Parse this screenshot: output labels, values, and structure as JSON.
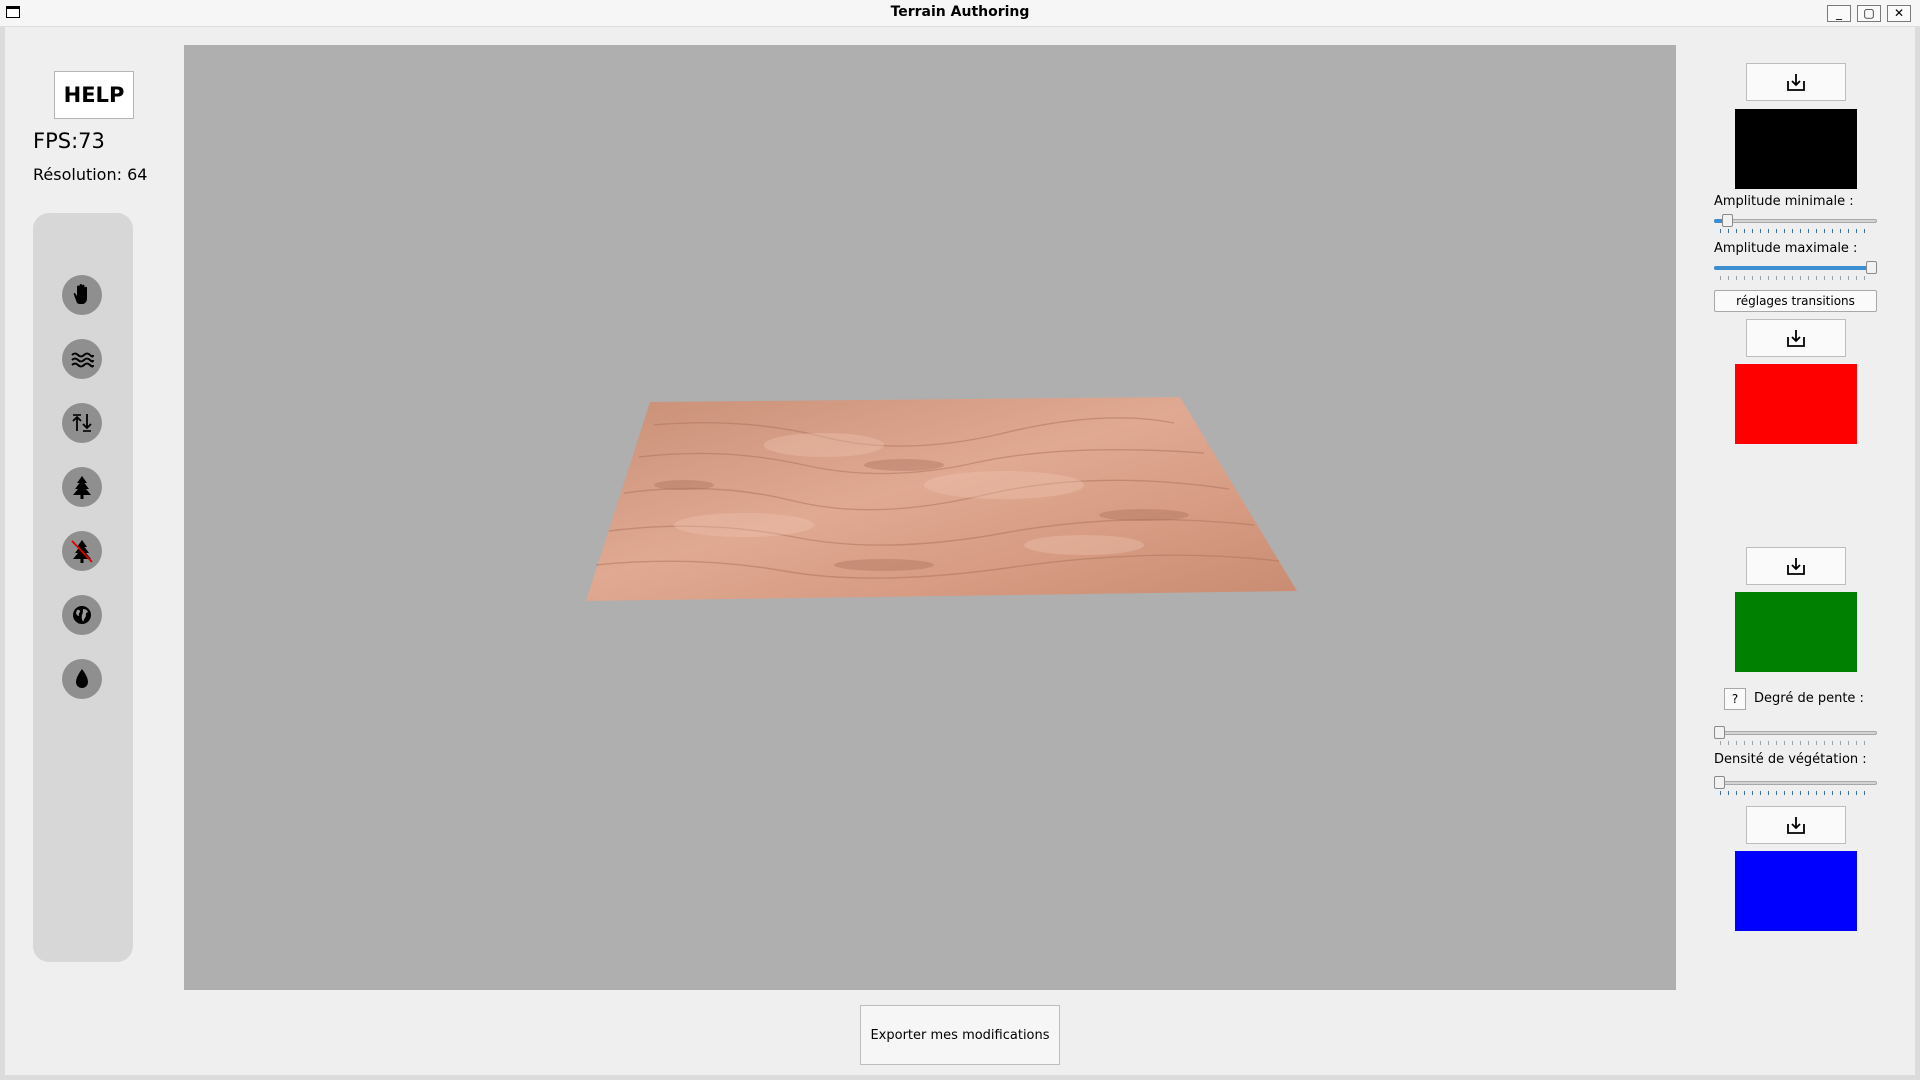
{
  "window": {
    "title": "Terrain Authoring"
  },
  "left": {
    "help_label": "HELP",
    "fps": "FPS:73",
    "resolution": "Résolution: 64"
  },
  "tools": [
    {
      "name": "pan-tool",
      "icon": "hand-icon"
    },
    {
      "name": "noise-tool",
      "icon": "waves-icon"
    },
    {
      "name": "raise-lower-tool",
      "icon": "up-down-arrows-icon"
    },
    {
      "name": "add-tree-tool",
      "icon": "tree-icon"
    },
    {
      "name": "remove-tree-tool",
      "icon": "no-tree-icon"
    },
    {
      "name": "globe-tool",
      "icon": "globe-icon"
    },
    {
      "name": "water-tool",
      "icon": "water-drop-icon"
    }
  ],
  "right": {
    "swatch_colors": [
      "#000000",
      "#ff0000",
      "#008000",
      "#0000ff"
    ],
    "amp_min_label": "Amplitude minimale :",
    "amp_min_value": 0.05,
    "amp_max_label": "Amplitude maximale :",
    "amp_max_value": 1.0,
    "transitions_label": "réglages transitions",
    "question_label": "?",
    "slope_label": "Degré de pente :",
    "slope_value": 0.0,
    "vegetation_label": "Densité de végétation :",
    "vegetation_value": 0.0
  },
  "export_label": "Exporter mes modifications"
}
